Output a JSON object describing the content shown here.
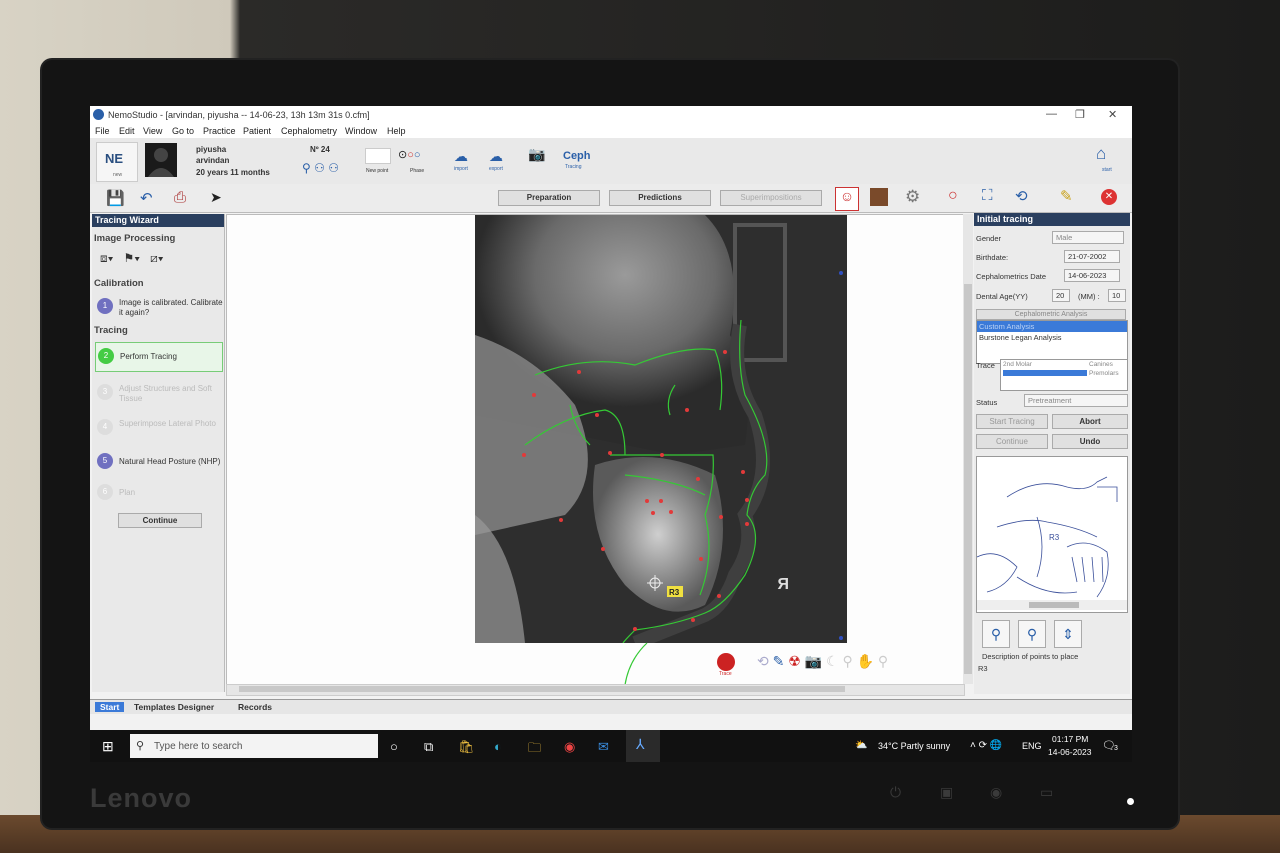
{
  "window": {
    "title": "NemoStudio - [arvindan, piyusha -- 14-06-23, 13h 13m 31s 0.cfm]",
    "min": "—",
    "restore": "❐",
    "close": "✕"
  },
  "menu": [
    "File",
    "Edit",
    "View",
    "Go to",
    "Practice",
    "Patient",
    "Cephalometry",
    "Window",
    "Help"
  ],
  "ribbon": {
    "badge": "NE",
    "badge_sub": "new",
    "patient_first": "piyusha",
    "patient_last": "arvindan",
    "patient_age": "20 years 11 months",
    "patient_no": "Nº 24",
    "new_point": "New point",
    "phase": "Phase",
    "import": "import",
    "export": "export",
    "ceph": "Ceph",
    "ceph_sub": "Tracing",
    "start": "start"
  },
  "toolbar": {
    "preparation": "Preparation",
    "predictions": "Predictions",
    "superimpositions": "Superimpositions"
  },
  "wizard": {
    "header": "Tracing Wizard",
    "image_processing": "Image Processing",
    "calibration": "Calibration",
    "tracing": "Tracing",
    "steps": [
      {
        "num": "1",
        "label": "Image is calibrated. Calibrate it again?"
      },
      {
        "num": "2",
        "label": "Perform Tracing"
      },
      {
        "num": "3",
        "label": "Adjust Structures and Soft Tissue"
      },
      {
        "num": "4",
        "label": "Superimpose Lateral Photo"
      },
      {
        "num": "5",
        "label": "Natural Head Posture (NHP)"
      },
      {
        "num": "6",
        "label": "Plan"
      }
    ],
    "continue": "Continue"
  },
  "canvas": {
    "point_label": "R3",
    "orientation": "R",
    "tool_label": "Trace"
  },
  "initial_tracing": {
    "header": "Initial tracing",
    "gender_label": "Gender",
    "gender_value": "Male",
    "birthdate_label": "Birthdate:",
    "birthdate_value": "21-07-2002",
    "ceph_date_label": "Cephalometrics Date",
    "ceph_date_value": "14-06-2023",
    "dental_age_label": "Dental Age(YY)",
    "dental_age_yy": "20",
    "mm_label": "(MM) :",
    "dental_age_mm": "10",
    "analysis_header": "Cephalometric Analysis",
    "analysis_items": [
      "Custom Analysis",
      "Burstone Legan Analysis"
    ],
    "trace_label": "Trace",
    "trace_left": "2nd Molar",
    "trace_right1": "Canines",
    "trace_right2": "Premolars",
    "status_label": "Status",
    "status_value": "Pretreatment",
    "start_tracing": "Start Tracing",
    "abort": "Abort",
    "continue": "Continue",
    "undo": "Undo",
    "preview_point": "R3",
    "description_label": "Description of points to place",
    "description_value": "R3"
  },
  "tabs": [
    "Start",
    "Templates Designer",
    "Records"
  ],
  "taskbar": {
    "search_placeholder": "Type here to search",
    "weather": "34°C  Partly sunny",
    "lang": "ENG",
    "time": "01:17 PM",
    "date": "14-06-2023",
    "notif": "3"
  },
  "monitor": {
    "brand": "Lenovo"
  }
}
